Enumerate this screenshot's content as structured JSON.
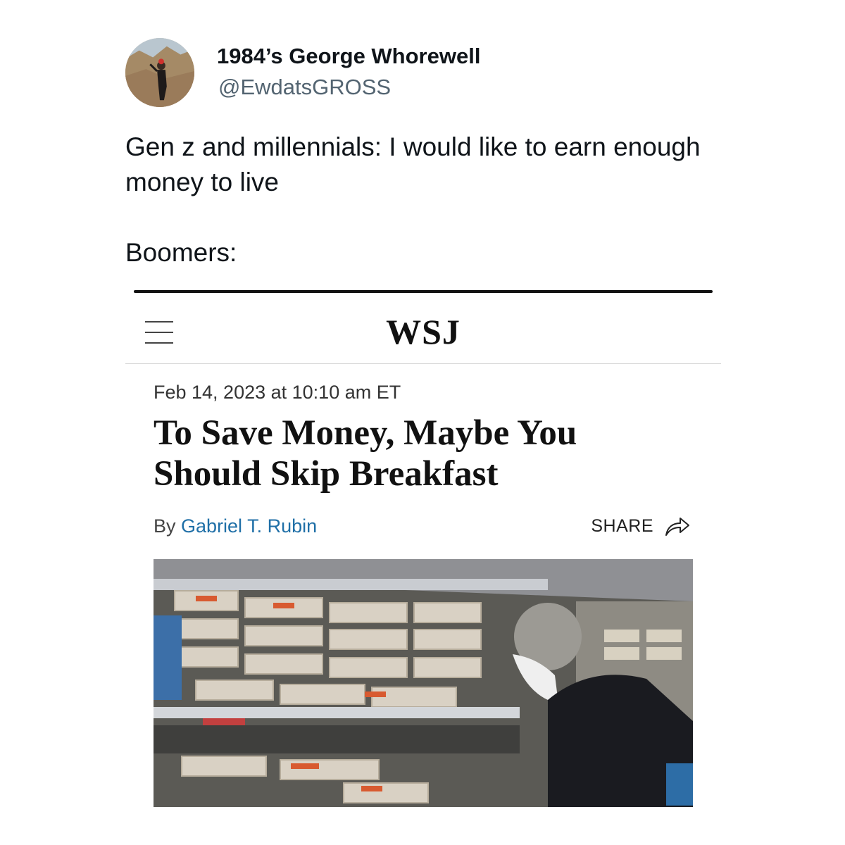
{
  "tweet": {
    "display_name": "1984’s George Whorewell",
    "handle": "@EwdatsGROSS",
    "text_lines": [
      "Gen z and millennials: I would like to earn enough money to live",
      "Boomers:"
    ]
  },
  "article": {
    "logo": "WSJ",
    "menu_icon": "hamburger-menu-icon",
    "dateline": "Feb 14, 2023 at 10:10 am ET",
    "headline": "To Save Money, Maybe You Should Skip Breakfast",
    "byline_prefix": "By ",
    "author": "Gabriel T. Rubin",
    "share_label": "SHARE",
    "share_icon": "share-arrow-icon",
    "author_color": "#1f6fa7"
  },
  "colors": {
    "handle_gray": "#536471"
  }
}
